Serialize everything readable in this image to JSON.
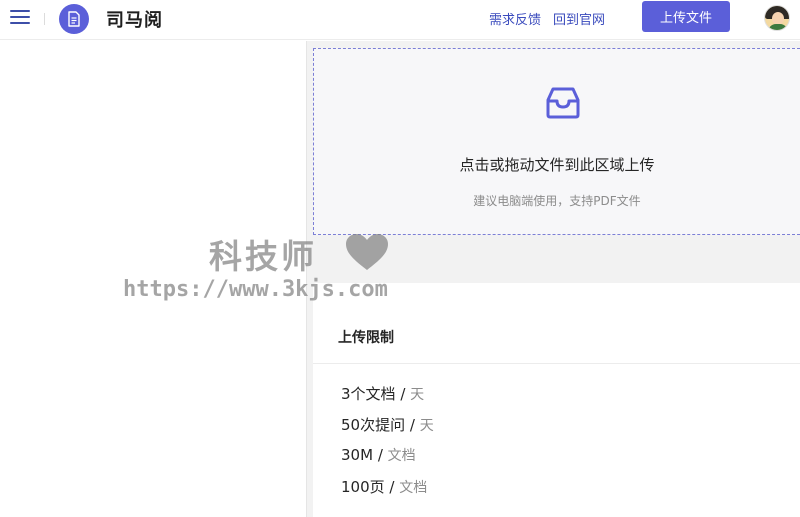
{
  "header": {
    "app_title": "司马阅",
    "links": [
      "需求反馈",
      "回到官网"
    ],
    "upload_label": "上传文件"
  },
  "dropzone": {
    "title": "点击或拖动文件到此区域上传",
    "subtitle": "建议电脑端使用，支持PDF文件"
  },
  "limits": {
    "title": "上传限制",
    "items": [
      {
        "value": "3个文档",
        "sep": "/",
        "unit": "天"
      },
      {
        "value": "50次提问",
        "sep": "/",
        "unit": "天"
      },
      {
        "value": "30M",
        "sep": "/",
        "unit": "文档"
      },
      {
        "value": "100页",
        "sep": "/",
        "unit": "文档"
      }
    ]
  },
  "watermark": {
    "title": "科技师",
    "url": "https://www.3kjs.com"
  },
  "colors": {
    "accent": "#5b5fd9",
    "link": "#3a4bbd",
    "dropzone_border": "#7c7fd6"
  },
  "icons": [
    "menu-icon",
    "document-icon",
    "inbox-icon",
    "heart-icon"
  ]
}
